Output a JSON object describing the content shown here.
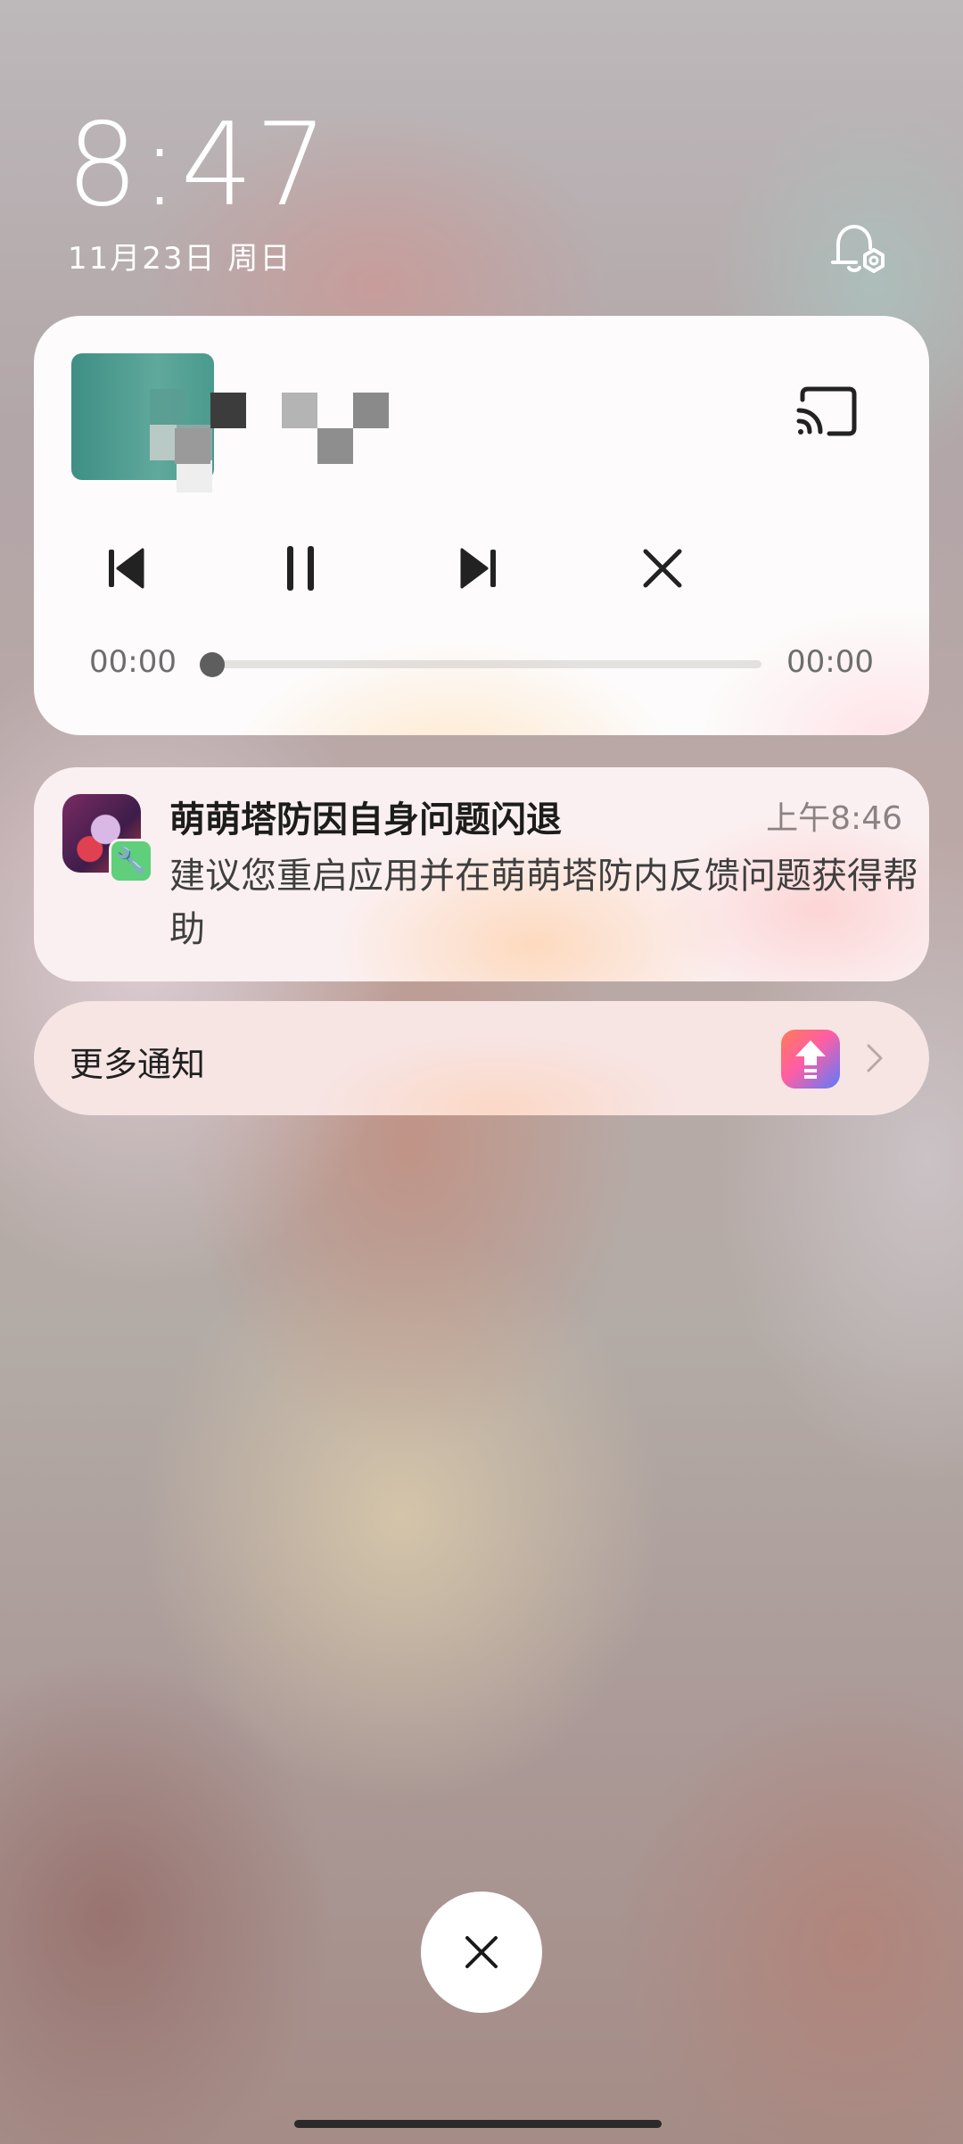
{
  "lockscreen": {
    "time": "8:47",
    "date": "11月23日 周日"
  },
  "media": {
    "elapsed": "00:00",
    "duration": "00:00",
    "progress": 0
  },
  "notification": {
    "title": "萌萌塔防因自身问题闪退",
    "time": "上午8:46",
    "body": "建议您重启应用并在萌萌塔防内反馈问题获得帮助"
  },
  "more_notifications": {
    "label": "更多通知"
  },
  "icons": {
    "bell_settings": "notification-settings-icon",
    "cast": "cast-icon",
    "previous": "skip-previous-icon",
    "pause": "pause-icon",
    "next": "skip-next-icon",
    "close": "close-icon",
    "dismiss": "close-icon",
    "chevron": "chevron-right-icon"
  }
}
